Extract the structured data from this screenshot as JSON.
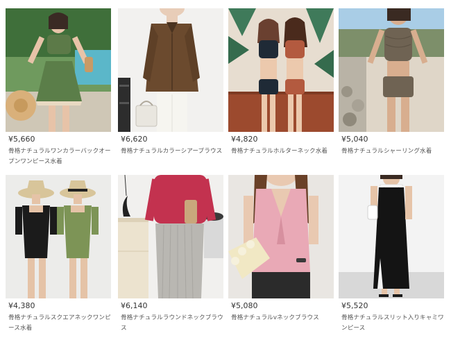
{
  "products": [
    {
      "price": "¥5,660",
      "name": "骨格ナチュラルワンカラーバックオープンワンピース水着",
      "image": "green-skirted-swimsuit-photo"
    },
    {
      "price": "¥6,620",
      "name": "骨格ナチュラルカラーシアーブラウス",
      "image": "brown-sheer-blouse-photo"
    },
    {
      "price": "¥4,820",
      "name": "骨格ナチュラルホルターネック水着",
      "image": "halter-neck-bikini-photo"
    },
    {
      "price": "¥5,040",
      "name": "骨格ナチュラルシャーリング水着",
      "image": "shirring-swimsuit-photo"
    },
    {
      "price": "¥4,380",
      "name": "骨格ナチュラルスクエアネックワンピース水着",
      "image": "square-neck-swimsuit-photo"
    },
    {
      "price": "¥6,140",
      "name": "骨格ナチュラルラウンドネックブラウス",
      "image": "round-neck-blouse-photo"
    },
    {
      "price": "¥5,080",
      "name": "骨格ナチュラルvネックブラウス",
      "image": "v-neck-blouse-photo"
    },
    {
      "price": "¥5,520",
      "name": "骨格ナチュラルスリット入りキャミワンピース",
      "image": "slit-cami-dress-photo"
    }
  ]
}
